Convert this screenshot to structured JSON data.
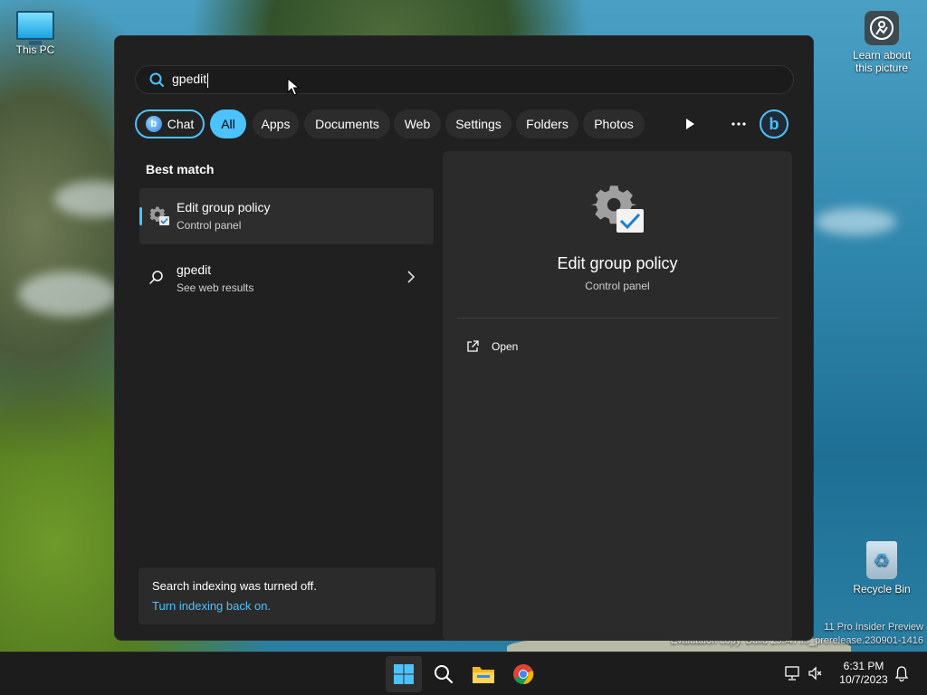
{
  "desktop": {
    "icons": [
      {
        "label": "This PC"
      },
      {
        "label": "Learn about this picture"
      },
      {
        "label": "Recycle Bin"
      }
    ],
    "watermark_line1": "11 Pro Insider Preview",
    "watermark_line2": "Evaluation copy. Build 25947.rs_prerelease.230901-1416"
  },
  "search": {
    "query": "gpedit"
  },
  "filters": [
    {
      "label": "Chat"
    },
    {
      "label": "All",
      "active": true
    },
    {
      "label": "Apps"
    },
    {
      "label": "Documents"
    },
    {
      "label": "Web"
    },
    {
      "label": "Settings"
    },
    {
      "label": "Folders"
    },
    {
      "label": "Photos"
    }
  ],
  "results": {
    "heading": "Best match",
    "best": {
      "title": "Edit group policy",
      "subtitle": "Control panel"
    },
    "web": {
      "title": "gpedit",
      "subtitle": "See web results"
    }
  },
  "detail": {
    "title": "Edit group policy",
    "subtitle": "Control panel",
    "actions": [
      {
        "label": "Open"
      }
    ]
  },
  "indexing": {
    "message": "Search indexing was turned off.",
    "link": "Turn indexing back on."
  },
  "taskbar": {
    "time": "6:31 PM",
    "date": "10/7/2023"
  },
  "colors": {
    "accent": "#4cc2ff",
    "panel_bg": "#202020",
    "detail_bg": "#2b2b2b"
  }
}
